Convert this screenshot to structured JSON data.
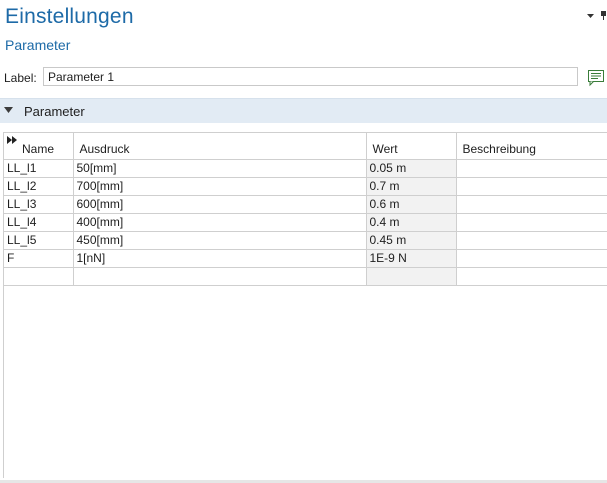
{
  "header": {
    "title": "Einstellungen",
    "subtitle": "Parameter"
  },
  "label_row": {
    "label": "Label:",
    "value": "Parameter 1"
  },
  "section": {
    "title": "Parameter"
  },
  "table": {
    "columns": [
      "Name",
      "Ausdruck",
      "Wert",
      "Beschreibung"
    ],
    "rows": [
      {
        "name": "LL_l1",
        "expression": "50[mm]",
        "value": "0.05 m",
        "description": ""
      },
      {
        "name": "LL_l2",
        "expression": "700[mm]",
        "value": "0.7 m",
        "description": ""
      },
      {
        "name": "LL_l3",
        "expression": "600[mm]",
        "value": "0.6 m",
        "description": ""
      },
      {
        "name": "LL_l4",
        "expression": "400[mm]",
        "value": "0.4 m",
        "description": ""
      },
      {
        "name": "LL_l5",
        "expression": "450[mm]",
        "value": "0.45 m",
        "description": ""
      },
      {
        "name": "F",
        "expression": "1[nN]",
        "value": "1E-9 N",
        "description": ""
      },
      {
        "name": "",
        "expression": "",
        "value": "",
        "description": ""
      }
    ]
  },
  "colors": {
    "accent": "#1d6aa7",
    "section_background": "#e2ebf4",
    "value_cell_background": "#f2f2f2",
    "grid_line": "#cfcfcf"
  },
  "icons": {
    "window_menu": "chevron-down-icon",
    "pin": "pin-icon",
    "label_action": "comment-list-icon",
    "section_toggle": "triangle-down-icon",
    "table_expand": "double-arrow-right-icon"
  }
}
